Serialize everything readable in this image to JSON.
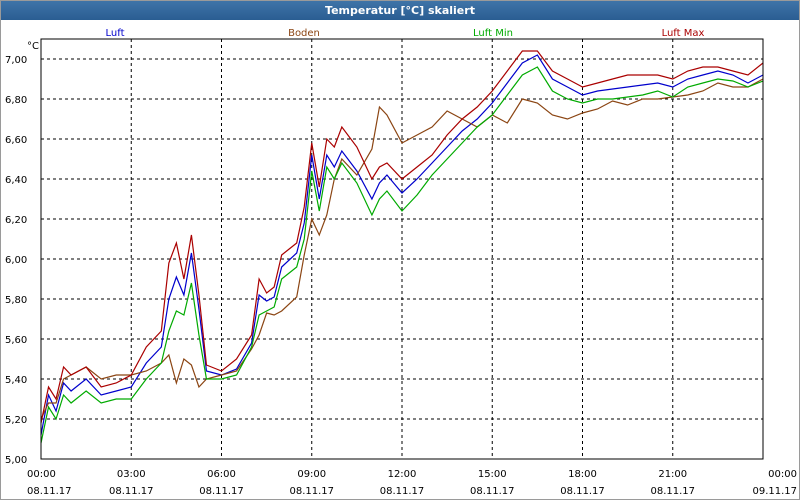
{
  "window": {
    "title": "Temperatur [°C] skaliert"
  },
  "chart_data": {
    "type": "line",
    "title": "Temperatur [°C] skaliert",
    "ylabel": "°C",
    "xlabel": "",
    "ylim": [
      5.0,
      7.1
    ],
    "xlim": [
      0,
      24
    ],
    "grid": true,
    "legend_placement": "top",
    "y_ticks": [
      "5,00",
      "5,20",
      "5,40",
      "5,60",
      "5,80",
      "6,00",
      "6,20",
      "6,40",
      "6,60",
      "6,80",
      "7,00"
    ],
    "y_tick_values": [
      5.0,
      5.2,
      5.4,
      5.6,
      5.8,
      6.0,
      6.2,
      6.4,
      6.6,
      6.8,
      7.0
    ],
    "x_tick_values": [
      0,
      3,
      6,
      9,
      12,
      15,
      18,
      21,
      24
    ],
    "x_ticks_time": [
      "00:00",
      "03:00",
      "06:00",
      "09:00",
      "12:00",
      "15:00",
      "18:00",
      "21:00",
      "00:00"
    ],
    "x_ticks_date": [
      "08.11.17",
      "08.11.17",
      "08.11.17",
      "08.11.17",
      "08.11.17",
      "08.11.17",
      "08.11.17",
      "08.11.17",
      "09.11.17"
    ],
    "x_hours": [
      0,
      0.25,
      0.5,
      0.75,
      1,
      1.5,
      2,
      2.5,
      3,
      3.5,
      4,
      4.25,
      4.5,
      4.75,
      5,
      5.25,
      5.5,
      6,
      6.5,
      7,
      7.25,
      7.5,
      7.75,
      8,
      8.5,
      8.75,
      9,
      9.25,
      9.5,
      9.75,
      10,
      10.5,
      11,
      11.25,
      11.5,
      12,
      12.5,
      13,
      13.5,
      14,
      14.5,
      15,
      15.5,
      16,
      16.5,
      17,
      17.5,
      18,
      18.5,
      19,
      19.5,
      20,
      20.5,
      21,
      21.5,
      22,
      22.5,
      23,
      23.5,
      24
    ],
    "series": [
      {
        "name": "Luft",
        "color": "#0000cc",
        "values": [
          5.12,
          5.32,
          5.24,
          5.38,
          5.34,
          5.4,
          5.32,
          5.34,
          5.36,
          5.48,
          5.56,
          5.8,
          5.91,
          5.82,
          6.03,
          5.75,
          5.44,
          5.42,
          5.45,
          5.58,
          5.82,
          5.79,
          5.81,
          5.96,
          6.03,
          6.18,
          6.52,
          6.3,
          6.52,
          6.46,
          6.54,
          6.44,
          6.3,
          6.38,
          6.42,
          6.33,
          6.4,
          6.48,
          6.56,
          6.64,
          6.7,
          6.78,
          6.88,
          6.98,
          7.02,
          6.9,
          6.86,
          6.82,
          6.84,
          6.85,
          6.86,
          6.87,
          6.88,
          6.86,
          6.9,
          6.92,
          6.94,
          6.92,
          6.88,
          6.92
        ]
      },
      {
        "name": "Boden",
        "color": "#8b4513",
        "values": [
          5.2,
          5.28,
          5.28,
          5.4,
          5.42,
          5.46,
          5.4,
          5.42,
          5.42,
          5.44,
          5.48,
          5.52,
          5.38,
          5.5,
          5.47,
          5.36,
          5.4,
          5.42,
          5.44,
          5.55,
          5.62,
          5.73,
          5.72,
          5.74,
          5.81,
          6.02,
          6.2,
          6.12,
          6.22,
          6.4,
          6.5,
          6.42,
          6.55,
          6.76,
          6.72,
          6.58,
          6.62,
          6.66,
          6.74,
          6.7,
          6.66,
          6.72,
          6.68,
          6.8,
          6.78,
          6.72,
          6.7,
          6.73,
          6.75,
          6.79,
          6.77,
          6.8,
          6.8,
          6.81,
          6.82,
          6.84,
          6.88,
          6.86,
          6.86,
          6.9
        ]
      },
      {
        "name": "Luft Min",
        "color": "#00aa00",
        "values": [
          5.08,
          5.26,
          5.2,
          5.32,
          5.28,
          5.34,
          5.28,
          5.3,
          5.3,
          5.4,
          5.48,
          5.64,
          5.74,
          5.72,
          5.88,
          5.62,
          5.4,
          5.4,
          5.42,
          5.56,
          5.72,
          5.74,
          5.76,
          5.9,
          5.96,
          6.1,
          6.44,
          6.24,
          6.46,
          6.4,
          6.48,
          6.38,
          6.22,
          6.3,
          6.34,
          6.24,
          6.32,
          6.42,
          6.5,
          6.58,
          6.66,
          6.72,
          6.82,
          6.92,
          6.96,
          6.84,
          6.8,
          6.78,
          6.8,
          6.8,
          6.81,
          6.82,
          6.84,
          6.81,
          6.86,
          6.88,
          6.9,
          6.89,
          6.86,
          6.89
        ]
      },
      {
        "name": "Luft Max",
        "color": "#aa0000",
        "values": [
          5.18,
          5.36,
          5.3,
          5.46,
          5.42,
          5.46,
          5.36,
          5.38,
          5.42,
          5.56,
          5.64,
          5.98,
          6.08,
          5.9,
          6.12,
          5.82,
          5.47,
          5.44,
          5.5,
          5.62,
          5.9,
          5.83,
          5.86,
          6.02,
          6.08,
          6.26,
          6.58,
          6.36,
          6.6,
          6.56,
          6.66,
          6.56,
          6.4,
          6.46,
          6.48,
          6.4,
          6.46,
          6.52,
          6.62,
          6.7,
          6.76,
          6.84,
          6.94,
          7.04,
          7.04,
          6.94,
          6.9,
          6.86,
          6.88,
          6.9,
          6.92,
          6.92,
          6.92,
          6.9,
          6.94,
          6.96,
          6.96,
          6.94,
          6.92,
          6.98
        ]
      }
    ]
  }
}
